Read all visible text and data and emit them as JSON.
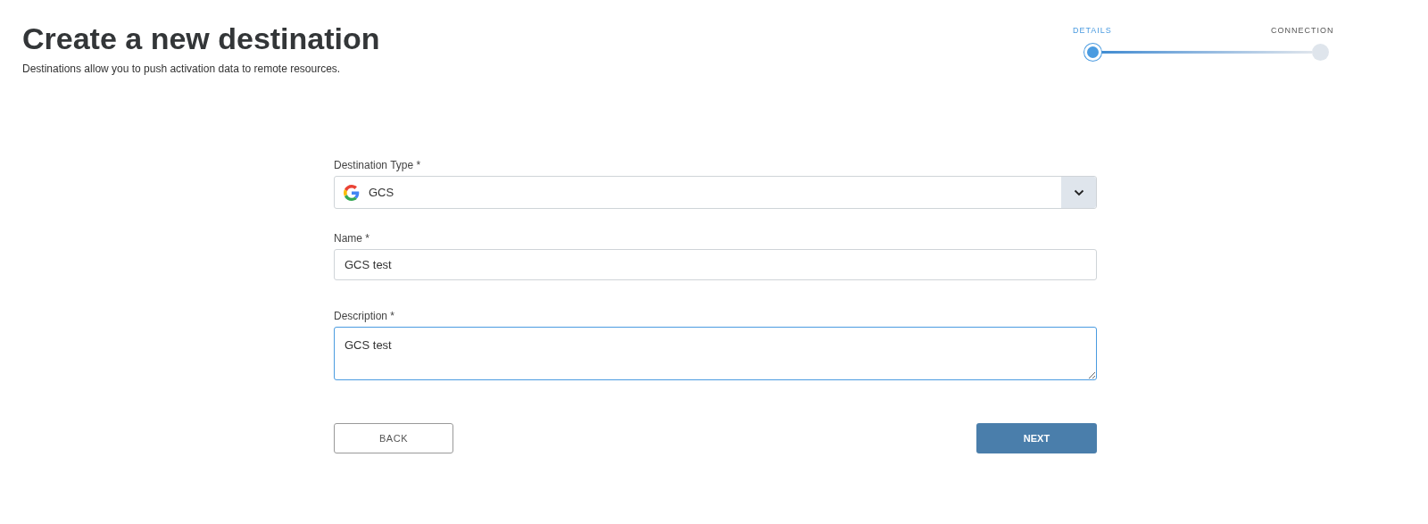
{
  "header": {
    "title": "Create a new destination",
    "subtitle": "Destinations allow you to push activation data to remote resources."
  },
  "steps": [
    {
      "label": "DETAILS",
      "selected": true
    },
    {
      "label": "CONNECTION",
      "selected": false
    }
  ],
  "form": {
    "fields": [
      {
        "kind": "select",
        "label": "Destination Type *",
        "value": "GCS",
        "focused": false
      },
      {
        "kind": "text",
        "label": "Name *",
        "value": "GCS test",
        "focused": false
      },
      {
        "kind": "textarea",
        "label": "Description *",
        "value": "GCS test",
        "focused": true
      }
    ]
  },
  "buttons": [
    {
      "kind": "secondary",
      "label": "BACK"
    },
    {
      "kind": "primary",
      "label": "NEXT"
    }
  ]
}
